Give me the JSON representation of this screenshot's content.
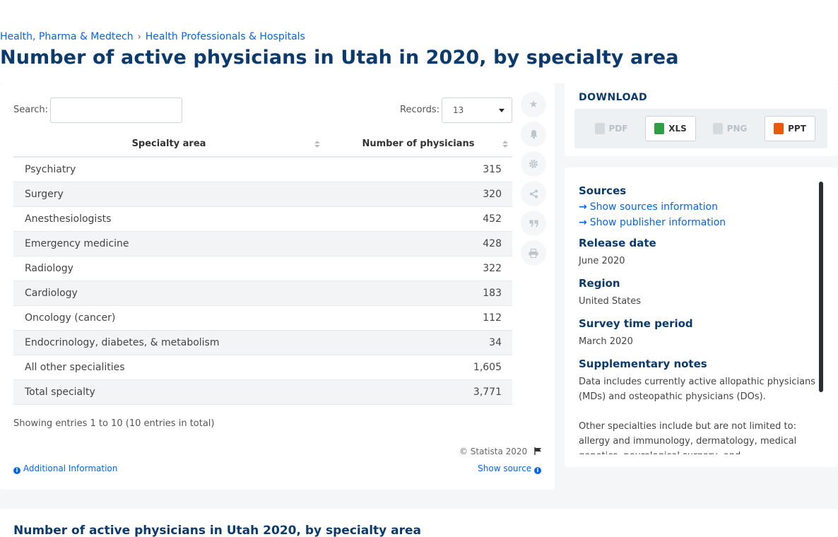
{
  "breadcrumb": {
    "items": [
      "Health, Pharma & Medtech",
      "Health Professionals & Hospitals"
    ],
    "separator": "›"
  },
  "page_title": "Number of active physicians in Utah in 2020, by specialty area",
  "controls": {
    "search_label": "Search:",
    "search_value": "",
    "records_label": "Records:",
    "records_value": "13"
  },
  "table": {
    "headers": [
      "Specialty area",
      "Number of physicians"
    ],
    "rows": [
      [
        "Psychiatry",
        "315"
      ],
      [
        "Surgery",
        "320"
      ],
      [
        "Anesthesiologists",
        "452"
      ],
      [
        "Emergency medicine",
        "428"
      ],
      [
        "Radiology",
        "322"
      ],
      [
        "Cardiology",
        "183"
      ],
      [
        "Oncology (cancer)",
        "112"
      ],
      [
        "Endocrinology, diabetes, & metabolism",
        "34"
      ],
      [
        "All other specialities",
        "1,605"
      ],
      [
        "Total specialty",
        "3,771"
      ]
    ]
  },
  "footer": {
    "showing": "Showing entries 1 to 10 (10 entries in total)",
    "copyright": "© Statista 2020",
    "additional_info": "Additional Information",
    "show_source": "Show source"
  },
  "tools": [
    "star-icon",
    "bell-icon",
    "gear-icon",
    "share-icon",
    "quote-icon",
    "print-icon"
  ],
  "download": {
    "title": "DOWNLOAD",
    "buttons": [
      {
        "label": "PDF",
        "enabled": false
      },
      {
        "label": "XLS",
        "enabled": true
      },
      {
        "label": "PNG",
        "enabled": false
      },
      {
        "label": "PPT",
        "enabled": true
      }
    ]
  },
  "meta": {
    "sources_title": "Sources",
    "show_sources": "Show sources information",
    "show_publisher": "Show publisher information",
    "release_date_title": "Release date",
    "release_date": "June 2020",
    "region_title": "Region",
    "region": "United States",
    "survey_title": "Survey time period",
    "survey": "March 2020",
    "notes_title": "Supplementary notes",
    "notes_1": "Data includes currently active allopathic physicians (MDs) and osteopathic physicians (DOs).",
    "notes_2": "Other specialties include but are not limited to: allergy and immunology, dermatology, medical genetics, neurological surgery, and"
  },
  "bottom_title": "Number of active physicians in Utah 2020, by specialty area",
  "colors": {
    "accent": "#0666e5",
    "title": "#0b3a6c",
    "background": "#f4f6f8"
  }
}
